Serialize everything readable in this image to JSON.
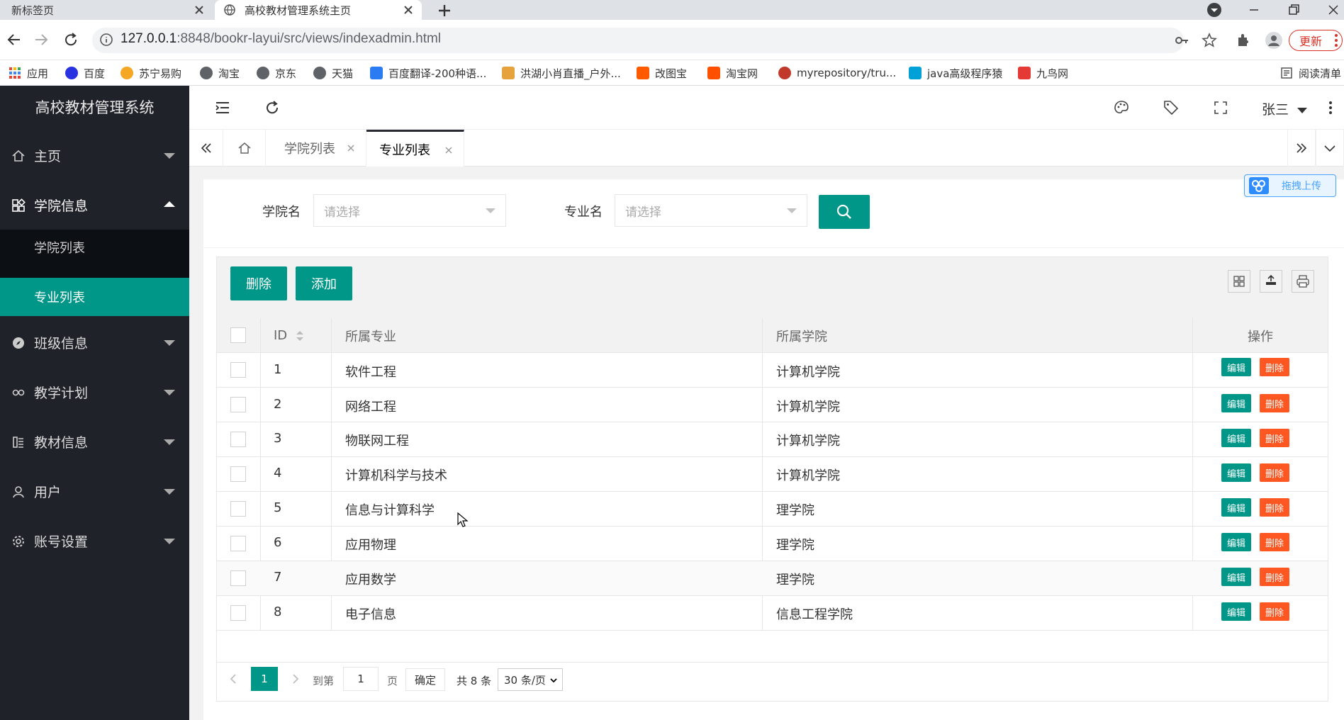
{
  "browser": {
    "tabs": [
      {
        "label": "新标签页",
        "active": false
      },
      {
        "label": "高校教材管理系统主页",
        "active": true
      }
    ],
    "url_host": "127.0.0.1",
    "url_path": ":8848/bookr-layui/src/views/indexadmin.html",
    "update_label": "更新",
    "bookmarks": [
      {
        "label": "应用",
        "color": "#4285f4"
      },
      {
        "label": "百度",
        "color": "#2932e1"
      },
      {
        "label": "苏宁易购",
        "color": "#f5a623"
      },
      {
        "label": "淘宝",
        "color": "#5f6368"
      },
      {
        "label": "京东",
        "color": "#5f6368"
      },
      {
        "label": "天猫",
        "color": "#5f6368"
      },
      {
        "label": "百度翻译-200种语...",
        "color": "#2b7bf3"
      },
      {
        "label": "洪湖小肖直播_户外...",
        "color": "#e6a23c"
      },
      {
        "label": "改图宝",
        "color": "#ff5a00"
      },
      {
        "label": "淘宝网",
        "color": "#ff5000"
      },
      {
        "label": "myrepository/tru...",
        "color": "#c0392b"
      },
      {
        "label": "java高级程序猿",
        "color": "#00a1d6"
      },
      {
        "label": "九鸟网",
        "color": "#e53935"
      },
      {
        "label": "阅读清单",
        "color": "#5f6368"
      }
    ]
  },
  "app": {
    "title": "高校教材管理系统",
    "user": "张三",
    "accent": "#009688",
    "danger": "#ff5722"
  },
  "sidebar": {
    "items": [
      {
        "label": "主页",
        "icon": "home-icon"
      },
      {
        "label": "学院信息",
        "icon": "apps-icon",
        "open": true
      },
      {
        "label": "班级信息",
        "icon": "compass-icon"
      },
      {
        "label": "教学计划",
        "icon": "link-icon"
      },
      {
        "label": "教材信息",
        "icon": "book-icon"
      },
      {
        "label": "用户",
        "icon": "user-icon"
      },
      {
        "label": "账号设置",
        "icon": "gear-icon"
      }
    ],
    "submenu": [
      {
        "label": "学院列表",
        "active": false
      },
      {
        "label": "专业列表",
        "active": true
      }
    ]
  },
  "pagetabs": [
    {
      "label": "学院列表",
      "active": false
    },
    {
      "label": "专业列表",
      "active": true
    }
  ],
  "filters": {
    "college_label": "学院名",
    "college_placeholder": "请选择",
    "major_label": "专业名",
    "major_placeholder": "请选择"
  },
  "baidu_upload": "拖拽上传",
  "toolbar": {
    "delete_label": "删除",
    "add_label": "添加"
  },
  "table": {
    "headers": {
      "id": "ID",
      "major": "所属专业",
      "college": "所属学院",
      "ops": "操作"
    },
    "edit_label": "编辑",
    "delete_label": "删除",
    "rows": [
      {
        "id": "1",
        "major": "软件工程",
        "college": "计算机学院"
      },
      {
        "id": "2",
        "major": "网络工程",
        "college": "计算机学院"
      },
      {
        "id": "3",
        "major": "物联网工程",
        "college": "计算机学院"
      },
      {
        "id": "4",
        "major": "计算机科学与技术",
        "college": "计算机学院"
      },
      {
        "id": "5",
        "major": "信息与计算科学",
        "college": "理学院"
      },
      {
        "id": "6",
        "major": "应用物理",
        "college": "理学院"
      },
      {
        "id": "7",
        "major": "应用数学",
        "college": "理学院"
      },
      {
        "id": "8",
        "major": "电子信息",
        "college": "信息工程学院"
      }
    ]
  },
  "pager": {
    "current": "1",
    "goto_label": "到第",
    "goto_value": "1",
    "page_label": "页",
    "ok_label": "确定",
    "total_label": "共 8 条",
    "size_label": "30 条/页"
  }
}
